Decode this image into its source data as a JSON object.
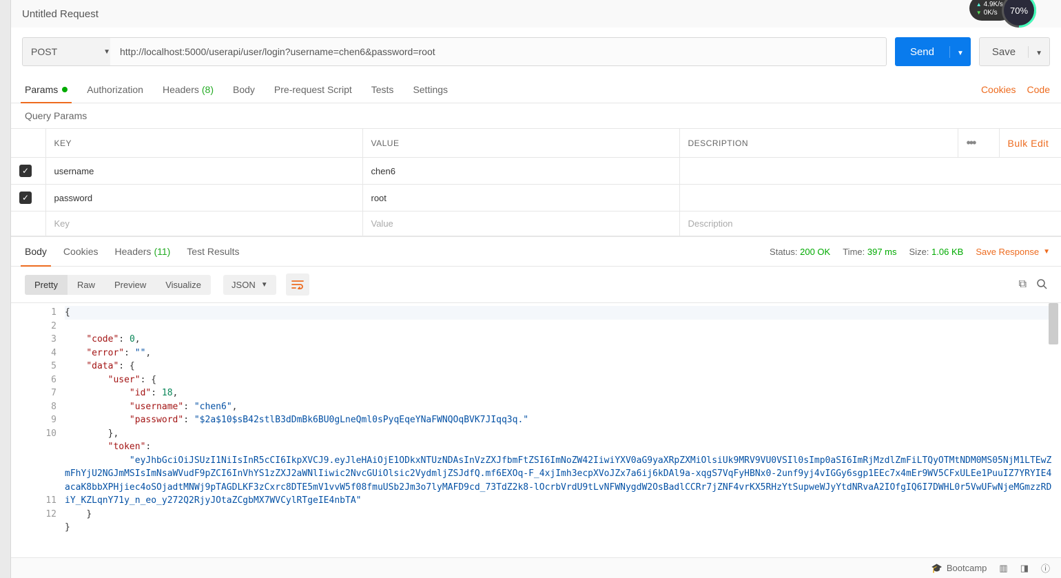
{
  "title": "Untitled Request",
  "net": {
    "up_speed": "4.9K/s",
    "down_speed": "0K/s",
    "percent": "70%"
  },
  "request": {
    "method": "POST",
    "url": "http://localhost:5000/userapi/user/login?username=chen6&password=root",
    "send_label": "Send",
    "save_label": "Save"
  },
  "req_tabs": {
    "params": "Params",
    "authorization": "Authorization",
    "headers": "Headers",
    "headers_count": "(8)",
    "body": "Body",
    "prerequest": "Pre-request Script",
    "tests": "Tests",
    "settings": "Settings",
    "cookies_link": "Cookies",
    "code_link": "Code"
  },
  "query_params": {
    "title": "Query Params",
    "headers": {
      "key": "KEY",
      "value": "VALUE",
      "description": "DESCRIPTION"
    },
    "rows": [
      {
        "enabled": true,
        "key": "username",
        "value": "chen6",
        "description": ""
      },
      {
        "enabled": true,
        "key": "password",
        "value": "root",
        "description": ""
      }
    ],
    "placeholders": {
      "key": "Key",
      "value": "Value",
      "description": "Description"
    },
    "bulk_edit": "Bulk Edit"
  },
  "resp_tabs": {
    "body": "Body",
    "cookies": "Cookies",
    "headers": "Headers",
    "headers_count": "(11)",
    "test_results": "Test Results"
  },
  "resp_meta": {
    "status_label": "Status:",
    "status_value": "200 OK",
    "time_label": "Time:",
    "time_value": "397 ms",
    "size_label": "Size:",
    "size_value": "1.06 KB",
    "save_response": "Save Response"
  },
  "view_bar": {
    "pretty": "Pretty",
    "raw": "Raw",
    "preview": "Preview",
    "visualize": "Visualize",
    "format": "JSON"
  },
  "response_json": {
    "code": 0,
    "error": "",
    "data": {
      "user": {
        "id": 18,
        "username": "chen6",
        "password": "$2a$10$sB42stlB3dDmBk6BU0gLneQml0sPyqEqeYNaFWNQOqBVK7JIqq3q."
      },
      "token": "eyJhbGciOiJSUzI1NiIsInR5cCI6IkpXVCJ9.eyJleHAiOjE1ODkxNTUzNDAsInVzZXJfbmFtZSI6ImNoZW42IiwiYXV0aG9yaXRpZXMiOlsiUk9MRV9VU0VSIl0sImp0aSI6ImRjMzdlZmFiLTQyOTMtNDM0MS05NjM1LTEwZmFhYjU2NGJmMSIsImNsaWVudF9pZCI6InVhYS1zZXJ2aWNlIiwic2NvcGUiOlsic2VydmljZSJdfQ.mf6EXOq-F_4xjImh3ecpXVoJZx7a6ij6kDAl9a-xqgS7VqFyHBNx0-2unf9yj4vIGGy6sgp1EEc7x4mEr9WV5CFxULEe1PuuIZ7YRYIE4acaK8bbXPHjiec4oSOjadtMNWj9pTAGDLKF3zCxrc8DTE5mV1vvW5f08fmuUSb2Jm3o7lyMAFD9cd_73TdZ2k8-lOcrbVrdU9tLvNFWNygdW2OsBadlCCRr7jZNF4vrKX5RHzYtSupweWJyYtdNRvaA2IOfgIQ6I7DWHL0r5VwUFwNjeMGmzzRDiY_KZLqnY71y_n_eo_y272Q2RjyJOtaZCgbMX7WVCylRTgeIE4nbTA"
    }
  },
  "footer": {
    "bootcamp": "Bootcamp"
  }
}
